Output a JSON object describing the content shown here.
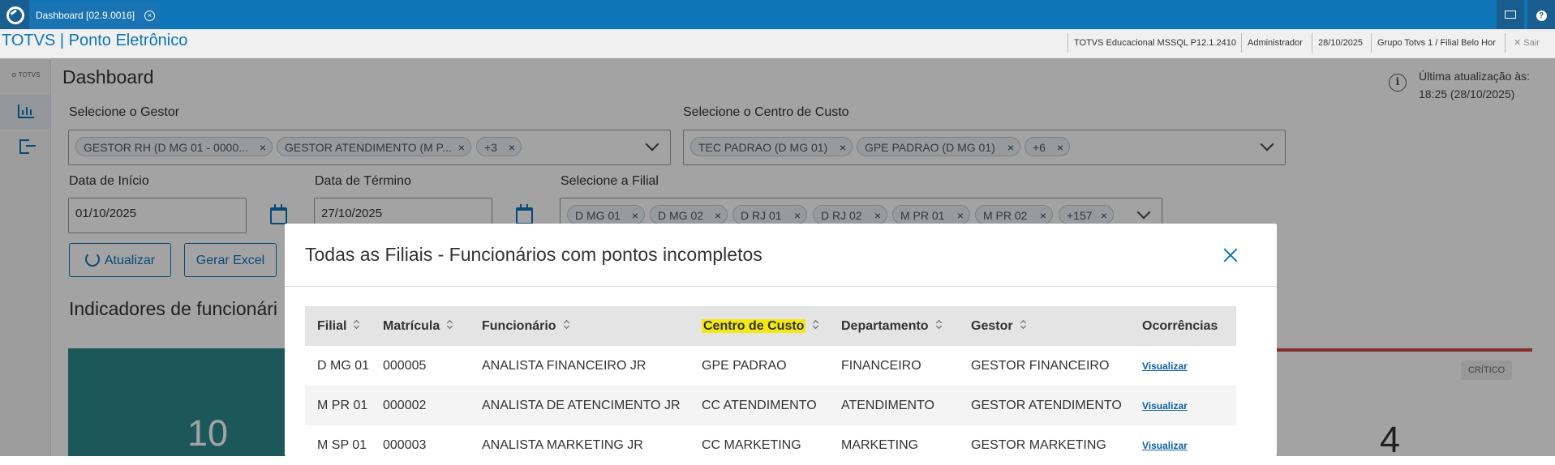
{
  "topbar": {
    "tab_title": "Dashboard [02.9.0016]",
    "close_symbol": "⊗",
    "mail_icon": "mail-icon",
    "help_symbol": "?"
  },
  "subbar": {
    "app_title": "TOTVS | Ponto Eletrônico",
    "environment": "TOTVS Educacional MSSQL P12.1.2410",
    "user": "Administrador",
    "date": "28/10/2025",
    "branch": "Grupo Totvs 1 / Filial Belo Hor",
    "logout": "Sair"
  },
  "sidebar": {
    "logo_text": "TOTVS",
    "items": [
      {
        "name": "dashboard",
        "icon": "bar-chart-icon"
      },
      {
        "name": "logout",
        "icon": "exit-icon"
      }
    ]
  },
  "page": {
    "title": "Dashboard",
    "last_update_label": "Última atualização às:",
    "last_update_value": "18:25 (28/10/2025)"
  },
  "filters": {
    "gestor_label": "Selecione o Gestor",
    "gestor_chips": [
      "GESTOR RH (D MG 01 - 0000...",
      "GESTOR ATENDIMENTO (M P...",
      "+3"
    ],
    "centro_label": "Selecione o Centro de Custo",
    "centro_chips": [
      "TEC PADRAO (D MG 01)",
      "GPE PADRAO (D MG 01)",
      "+6"
    ],
    "inicio_label": "Data de Início",
    "inicio_value": "01/10/2025",
    "termino_label": "Data de Término",
    "termino_value": "27/10/2025",
    "filial_label": "Selecione a Filial",
    "filial_chips": [
      "D MG 01",
      "D MG 02",
      "D RJ 01",
      "D RJ 02",
      "M PR 01",
      "M PR 02",
      "+157"
    ]
  },
  "actions": {
    "refresh_label": "Atualizar",
    "excel_label": "Gerar Excel"
  },
  "indicators": {
    "section_title": "Indicadores de funcionári",
    "card1_value": "10",
    "card2_badge": "CRÍTICO",
    "card2_value": "4",
    "colors": {
      "teal": "#2d8a8e",
      "critical": "#d04c44"
    }
  },
  "modal": {
    "title": "Todas as Filiais - Funcionários com pontos incompletos",
    "columns": [
      "Filial",
      "Matrícula",
      "Funcionário",
      "Centro de Custo",
      "Departamento",
      "Gestor",
      "Ocorrências"
    ],
    "highlight_color": "#f4e812",
    "rows": [
      [
        "D MG 01",
        "000005",
        "ANALISTA FINANCEIRO JR",
        "GPE PADRAO",
        "FINANCEIRO",
        "GESTOR FINANCEIRO",
        "Visualizar"
      ],
      [
        "M PR 01",
        "000002",
        "ANALISTA DE ATENCIMENTO JR",
        "CC ATENDIMENTO",
        "ATENDIMENTO",
        "GESTOR ATENDIMENTO",
        "Visualizar"
      ],
      [
        "M SP 01",
        "000003",
        "ANALISTA MARKETING JR",
        "CC MARKETING",
        "MARKETING",
        "GESTOR MARKETING",
        "Visualizar"
      ]
    ]
  },
  "accent_color": "#0d75b8"
}
